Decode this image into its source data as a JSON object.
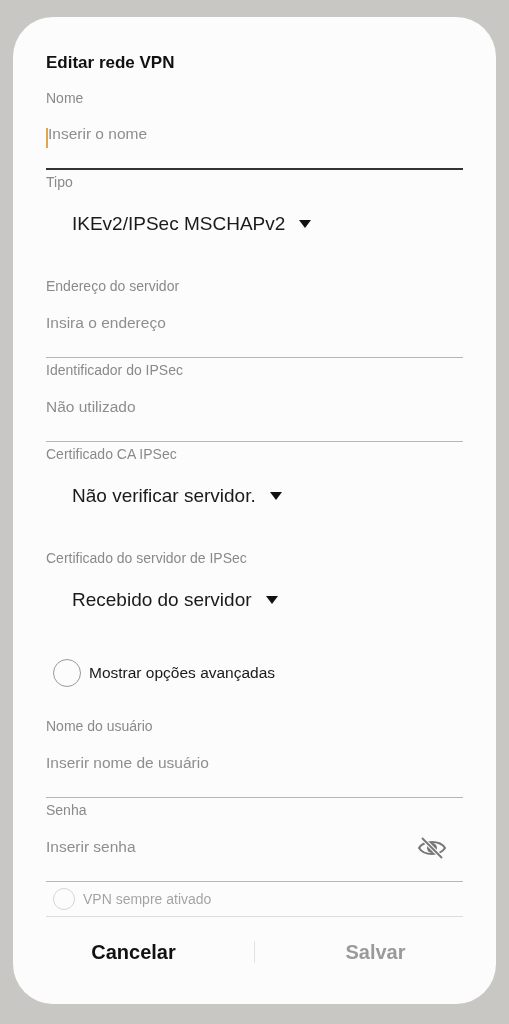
{
  "dialog": {
    "title": "Editar rede VPN"
  },
  "fields": [
    {
      "kind": "text",
      "label": "Nome",
      "placeholder": "Inserir o nome",
      "focused": true
    },
    {
      "kind": "dropdown",
      "label": "Tipo",
      "value": "IKEv2/IPSec MSCHAPv2"
    },
    {
      "kind": "text",
      "label": "Endereço do servidor",
      "placeholder": "Insira o endereço",
      "focused": false
    },
    {
      "kind": "text",
      "label": "Identificador do IPSec",
      "placeholder": "Não utilizado",
      "focused": false
    },
    {
      "kind": "dropdown",
      "label": "Certificado CA IPSec",
      "value": "Não verificar servidor."
    },
    {
      "kind": "dropdown",
      "label": "Certificado do servidor de IPSec",
      "value": "Recebido do servidor"
    },
    {
      "kind": "checkbox",
      "label": "Mostrar opções avançadas",
      "checked": false
    },
    {
      "kind": "text",
      "label": "Nome do usuário",
      "placeholder": "Inserir nome de usuário",
      "focused": false
    },
    {
      "kind": "password",
      "label": "Senha",
      "placeholder": "Inserir senha",
      "focused": false
    },
    {
      "kind": "checkbox",
      "label": "VPN sempre ativado",
      "checked": false,
      "faded": true
    }
  ],
  "buttons": [
    {
      "label": "Cancelar",
      "disabled": false
    },
    {
      "label": "Salvar",
      "disabled": true
    }
  ]
}
